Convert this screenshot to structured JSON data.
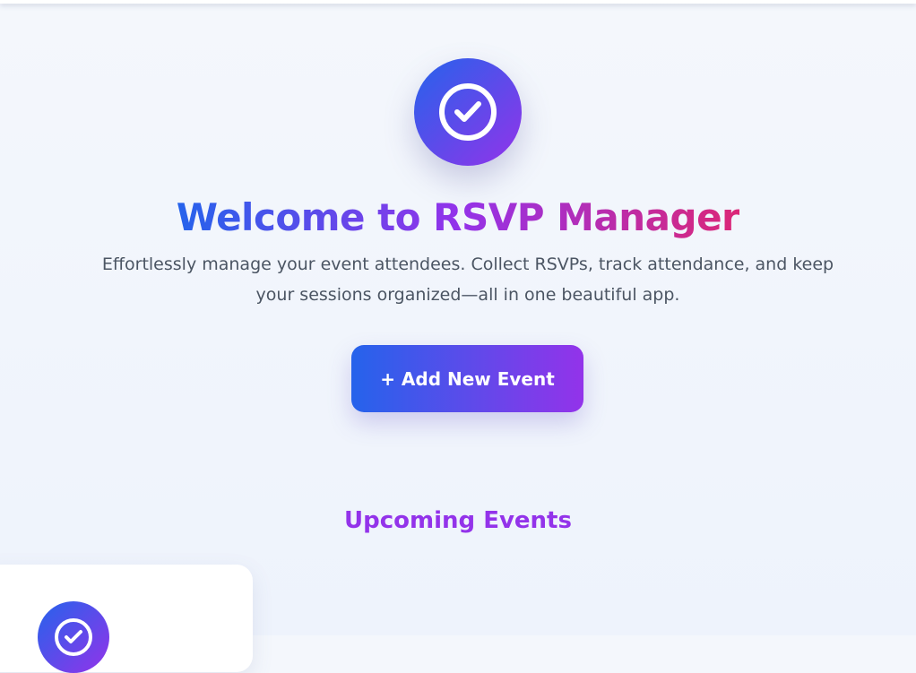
{
  "hero": {
    "icon": "check-circle-icon",
    "title": "Welcome to RSVP Manager",
    "subtitle": "Effortlessly manage your event attendees. Collect RSVPs, track attendance, and keep your sessions organized—all in one beautiful app.",
    "add_button_label": "+ Add New Event"
  },
  "events": {
    "heading": "Upcoming Events",
    "cards": [
      {
        "icon": "check-circle-icon"
      }
    ]
  },
  "colors": {
    "gradient_start": "#2563eb",
    "gradient_mid": "#9333ea",
    "gradient_end": "#db2777",
    "heading": "#9333ea",
    "body_text": "#4b5563"
  }
}
